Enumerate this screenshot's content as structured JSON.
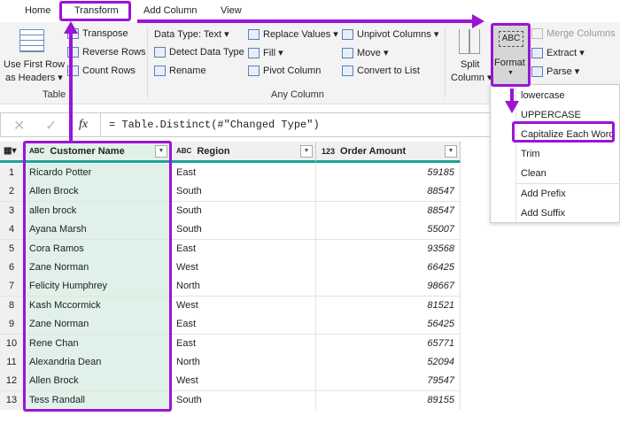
{
  "tabs": [
    "Home",
    "Transform",
    "Add Column",
    "View"
  ],
  "ribbon": {
    "use_first_row": "Use First Row",
    "as_headers": "as Headers ▾",
    "transpose": "Transpose",
    "reverse_rows": "Reverse Rows",
    "count_rows": "Count Rows",
    "group_table": "Table",
    "data_type": "Data Type: Text ▾",
    "detect_data_type": "Detect Data Type",
    "rename": "Rename",
    "replace_values": "Replace Values ▾",
    "fill": "Fill ▾",
    "pivot_column": "Pivot Column",
    "unpivot_columns": "Unpivot Columns ▾",
    "move": "Move ▾",
    "convert_to_list": "Convert to List",
    "group_any": "Any Column",
    "split": "Split",
    "column": "Column ▾",
    "format": "Format",
    "merge_columns": "Merge Columns",
    "extract": "Extract ▾",
    "parse": "Parse ▾"
  },
  "formula": {
    "text": "= Table.Distinct(#\"Changed Type\")",
    "fx": "fx"
  },
  "columns": [
    {
      "type": "ABC",
      "name": "Customer Name"
    },
    {
      "type": "ABC",
      "name": "Region"
    },
    {
      "type": "123",
      "name": "Order Amount"
    }
  ],
  "rows": [
    [
      "1",
      "Ricardo Potter",
      "East",
      "59185"
    ],
    [
      "2",
      "Allen Brock",
      "South",
      "88547"
    ],
    [
      "3",
      "allen brock",
      "South",
      "88547"
    ],
    [
      "4",
      "Ayana Marsh",
      "South",
      "55007"
    ],
    [
      "5",
      "Cora Ramos",
      "East",
      "93568"
    ],
    [
      "6",
      "Zane Norman",
      "West",
      "66425"
    ],
    [
      "7",
      "Felicity Humphrey",
      "North",
      "98667"
    ],
    [
      "8",
      "Kash Mccormick",
      "West",
      "81521"
    ],
    [
      "9",
      "Zane Norman",
      "East",
      "56425"
    ],
    [
      "10",
      "Rene Chan",
      "East",
      "65771"
    ],
    [
      "11",
      "Alexandria Dean",
      "North",
      "52094"
    ],
    [
      "12",
      "Allen Brock",
      "West",
      "79547"
    ],
    [
      "13",
      "Tess Randall",
      "South",
      "89155"
    ]
  ],
  "menu": [
    "lowercase",
    "UPPERCASE",
    "Capitalize Each Word",
    "Trim",
    "Clean",
    "Add Prefix",
    "Add Suffix"
  ],
  "colors": {
    "annotation": "#9b14d6",
    "column_selected": "#dff1e8",
    "accent": "#1aa39a"
  }
}
